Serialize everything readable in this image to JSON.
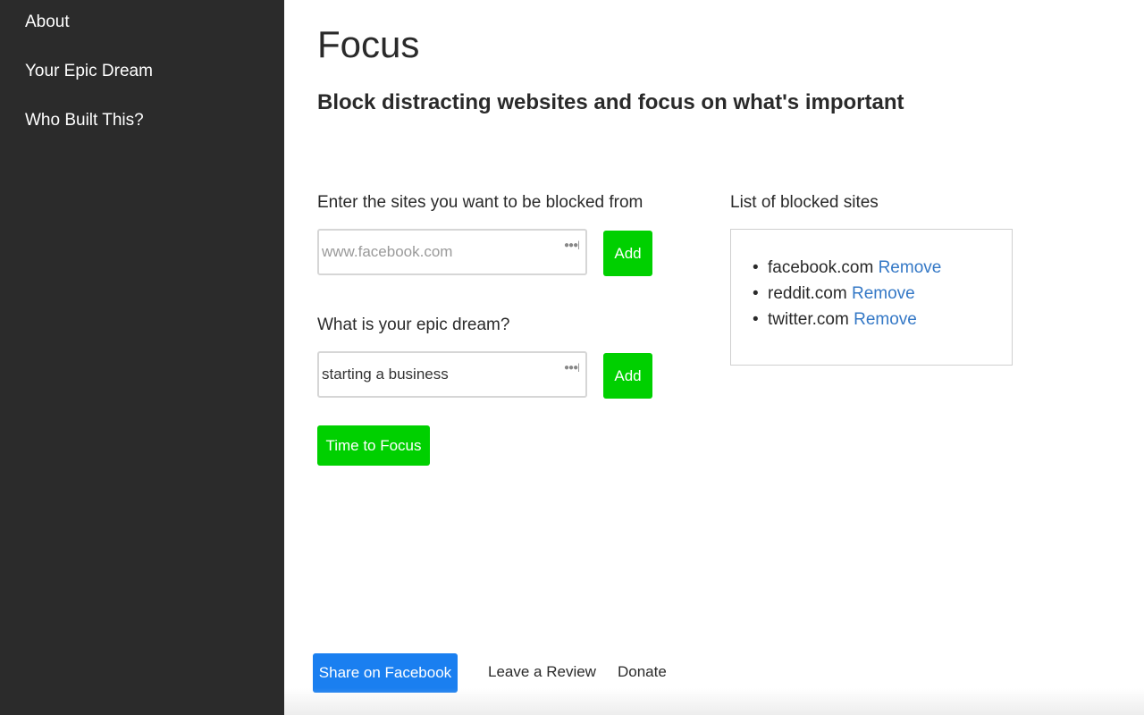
{
  "sidebar": {
    "items": [
      {
        "label": "About"
      },
      {
        "label": "Your Epic Dream"
      },
      {
        "label": "Who Built This?"
      }
    ]
  },
  "header": {
    "title": "Focus",
    "subtitle": "Block distracting websites and focus on what's important"
  },
  "sites_form": {
    "label": "Enter the sites you want to be blocked from",
    "placeholder": "www.facebook.com",
    "value": "",
    "add_label": "Add"
  },
  "dream_form": {
    "label": "What is your epic dream?",
    "placeholder": "",
    "value": "starting a business",
    "add_label": "Add"
  },
  "focus_button": {
    "label": "Time to Focus"
  },
  "blocked_list": {
    "title": "List of blocked sites",
    "remove_label": "Remove",
    "sites": [
      "facebook.com",
      "reddit.com",
      "twitter.com"
    ]
  },
  "footer": {
    "share_label": "Share on Facebook",
    "review_label": "Leave a Review",
    "donate_label": "Donate"
  },
  "colors": {
    "sidebar_bg": "#2b2b2b",
    "accent_green": "#00d000",
    "facebook_blue": "#1a7ff0",
    "link_blue": "#3478c6"
  },
  "icons": {
    "input_menu": "dots-icon",
    "bullet": "bullet-icon"
  }
}
